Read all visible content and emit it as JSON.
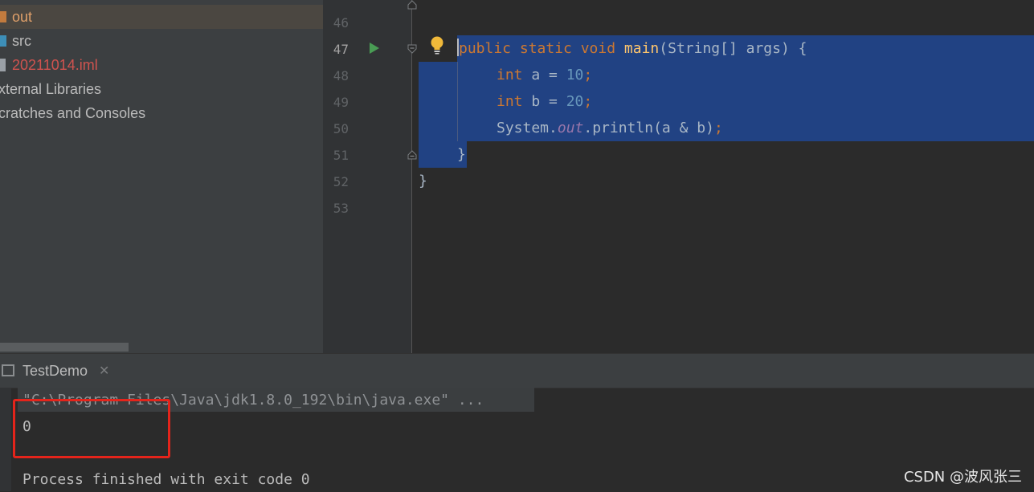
{
  "project_tree": {
    "items": [
      {
        "label": "out",
        "icon": "folder-icon",
        "color": "#e0a06a"
      },
      {
        "label": "src",
        "icon": "folder-icon",
        "color": "#bbbbbb"
      },
      {
        "label": "20211014.iml",
        "icon": "file-icon",
        "color": "#d0534f"
      },
      {
        "label": "xternal Libraries",
        "icon": "library-icon",
        "color": "#bbbbbb"
      },
      {
        "label": "cratches and Consoles",
        "icon": "scratch-icon",
        "color": "#bbbbbb"
      }
    ]
  },
  "editor": {
    "line_numbers": [
      "46",
      "47",
      "48",
      "49",
      "50",
      "51",
      "52",
      "53"
    ],
    "current_line": "47",
    "code": {
      "l47": {
        "kw1": "public static void ",
        "fn": "main",
        "rest": "(String[] args) {"
      },
      "l48": {
        "kw": "int",
        "mid": " a = ",
        "num": "10",
        "end": ";"
      },
      "l49": {
        "kw": "int",
        "mid": " b = ",
        "num": "20",
        "end": ";"
      },
      "l50": {
        "pre": "System.",
        "fld": "out",
        "rest": ".println(a & b)",
        "end": ";"
      },
      "l51": "}",
      "l52": "}"
    },
    "selection_color": "#214283"
  },
  "run_panel": {
    "tab_label": "TestDemo",
    "command": "\"C:\\Program Files\\Java\\jdk1.8.0_192\\bin\\java.exe\" ...",
    "output": "0",
    "finished": "Process finished with exit code 0"
  },
  "watermark": "CSDN @波风张三",
  "colors": {
    "keyword": "#cc7832",
    "function": "#ffc66d",
    "number": "#6897bb",
    "highlight_box": "#e4241b"
  }
}
